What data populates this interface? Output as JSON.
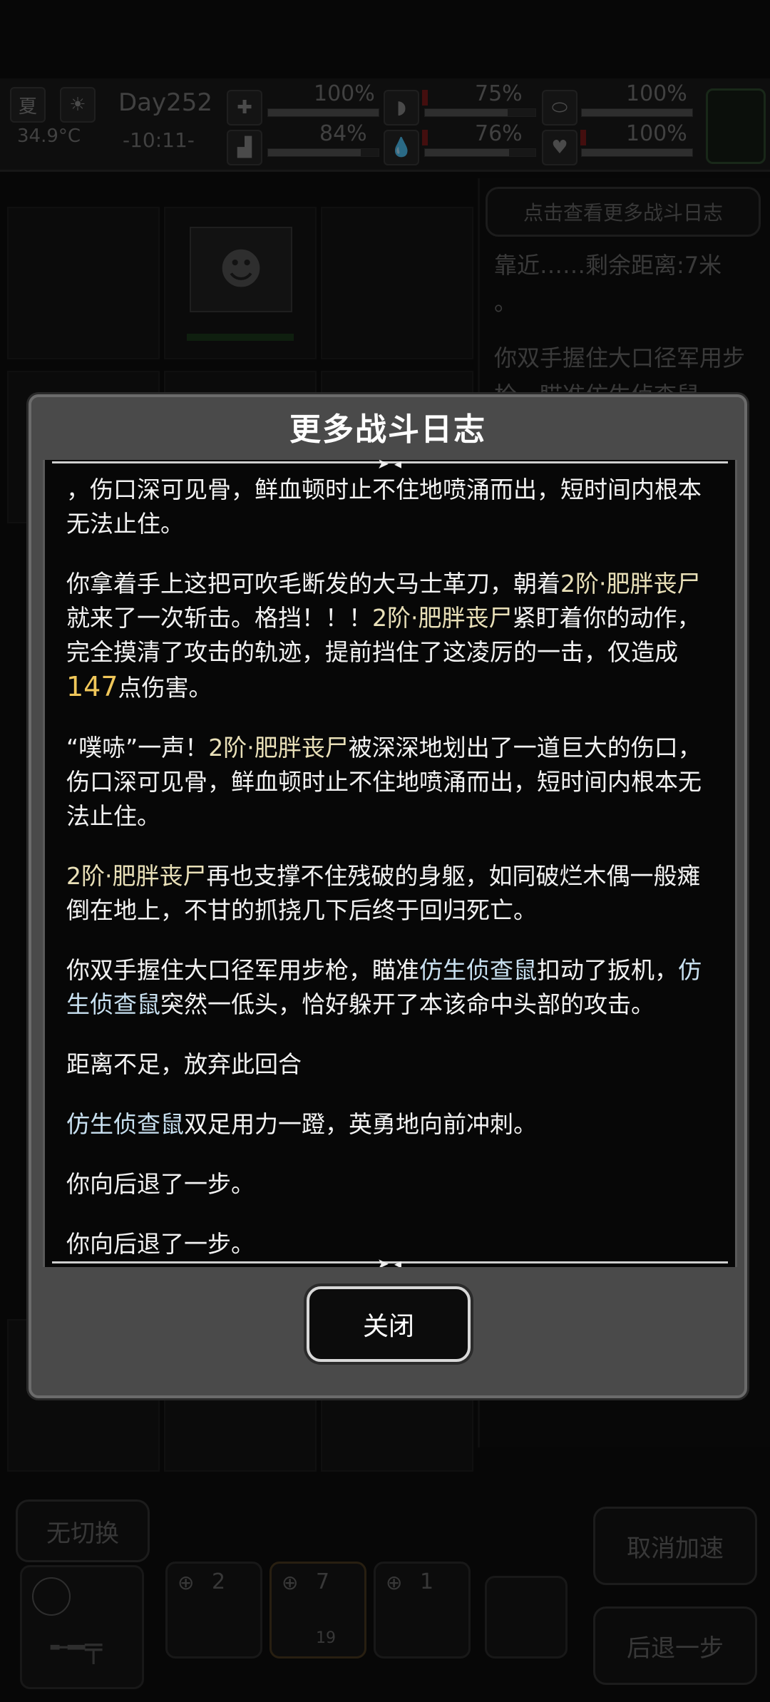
{
  "status": {
    "season": "夏",
    "temperature": "34.9°C",
    "day": "Day252",
    "time": "-10:11-",
    "health_pct": "100%",
    "stamina_pct": "84%",
    "hunger_pct": "75%",
    "thirst_pct": "76%",
    "mood_pct": "100%",
    "heart_pct": "100%"
  },
  "background_panel": {
    "more_log_button": "点击查看更多战斗日志",
    "approach_text": "靠近……剩余距离:7米",
    "dot": "。",
    "log_preview": "你双手握住大口径军用步枪，瞄准仿生侦查鼠"
  },
  "bottom_bar": {
    "no_switch": "无切换",
    "cancel_speed": "取消加速",
    "step_back": "后退一步",
    "slot_counts": [
      "2",
      "7",
      "1"
    ],
    "ammo": "19"
  },
  "modal": {
    "title": "更多战斗日志",
    "close_label": "关闭",
    "entries": [
      {
        "id": "e1",
        "text": "，伤口深可见骨，鲜血顿时止不住地喷涌而出，短时间内根本无法止住。"
      },
      {
        "id": "e2",
        "p1": "你拿着手上这把可吹毛断发的大马士革刀，朝着",
        "hl1": "2阶·肥胖丧尸",
        "p2": "就来了一次斩击。格挡！！！",
        "hl2": "2阶·肥胖丧尸",
        "p3": "紧盯着你的动作，完全摸清了攻击的轨迹，提前挡住了这凌厉的一击，仅造成",
        "dmg": "147",
        "p4": "点伤害。"
      },
      {
        "id": "e3",
        "p1": "“噗哧”一声！",
        "hl1": "2阶·肥胖丧尸",
        "p2": "被深深地划出了一道巨大的伤口，伤口深可见骨，鲜血顿时止不住地喷涌而出，短时间内根本无法止住。"
      },
      {
        "id": "e4",
        "hl1": "2阶·肥胖丧尸",
        "p1": "再也支撑不住残破的身躯，如同破烂木偶一般瘫倒在地上，不甘的抓挠几下后终于回归死亡。"
      },
      {
        "id": "e5",
        "p1": "你双手握住大口径军用步枪，瞄准",
        "en1": "仿生侦查鼠",
        "p2": "扣动了扳机，",
        "en2": "仿生侦查鼠",
        "p3": "突然一低头，恰好躲开了本该命中头部的攻击。"
      },
      {
        "id": "e6",
        "text": "距离不足，放弃此回合"
      },
      {
        "id": "e7",
        "en1": "仿生侦查鼠",
        "p1": "双足用力一蹬，英勇地向前冲刺。"
      },
      {
        "id": "e8",
        "text": "你向后退了一步。"
      },
      {
        "id": "e9",
        "text": "你向后退了一步。"
      }
    ]
  },
  "colors": {
    "highlight_enemy": "#e9e0b8",
    "highlight_rat": "#c8e0f0",
    "damage": "#f0c75a",
    "modal_bg": "#4a4a4a"
  }
}
